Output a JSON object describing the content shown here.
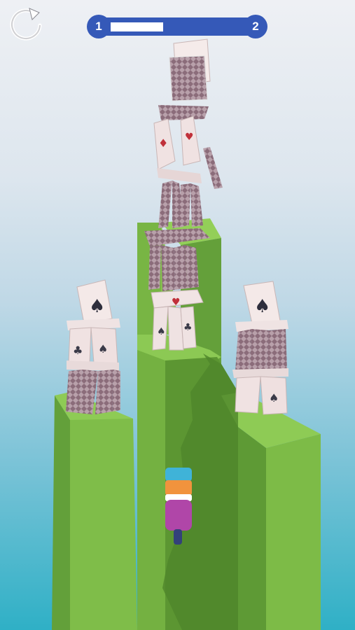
{
  "hud": {
    "current_level": "1",
    "next_level": "2",
    "progress": 0.42,
    "restart_icon": "restart-icon"
  },
  "colors": {
    "progress_bar": "#3559b8",
    "progress_fill": "#ffffff",
    "pillar_top": "#7ec24a",
    "pillar_side": "#5e9a35",
    "card_back": "#8a6f7a",
    "card_face": "#f2e6e6"
  }
}
